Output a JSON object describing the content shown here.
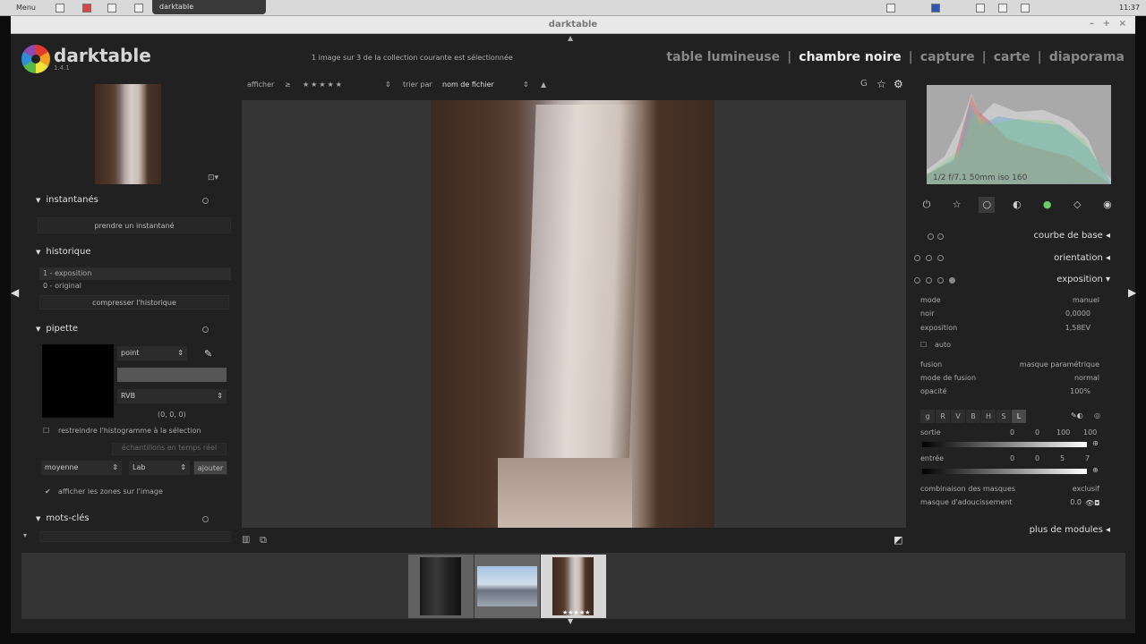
{
  "system": {
    "left_text": "Menu",
    "task_title": "darktable",
    "clock": "11:37"
  },
  "window": {
    "title": "darktable",
    "minimize": "–",
    "maximize": "+",
    "close": "×"
  },
  "app": {
    "name": "darktable",
    "version": "1.4.1",
    "selection_info": "1 image sur 3 de la collection courante est sélectionnée"
  },
  "views": [
    "table lumineuse",
    "chambre noire",
    "capture",
    "carte",
    "diaporama"
  ],
  "views_sep": "|",
  "left": {
    "snapshots": {
      "title": "instantanés",
      "button": "prendre un instantané"
    },
    "history": {
      "title": "historique",
      "items": [
        "1 - exposition",
        "0 - original"
      ],
      "compress": "compresser l'historique"
    },
    "pipette": {
      "title": "pipette",
      "mode": "point",
      "model": "RVB",
      "values": "(0, 0, 0)",
      "restrict_label": "restreindre l'histogramme à la sélection",
      "live_label": "échantillons en temps réel",
      "stat": "moyenne",
      "space": "Lab",
      "add": "ajouter",
      "show_zones": "afficher les zones sur l'image"
    },
    "tags": {
      "title": "mots-clés"
    }
  },
  "center_toolbar": {
    "show_label": "afficher",
    "stars": "★★★★★",
    "sort_label": "trier par",
    "sort_value": "nom de fichier"
  },
  "right": {
    "hist_info": "1/2 f/7.1 50mm iso 160",
    "modules": [
      "courbe de base",
      "orientation",
      "exposition"
    ],
    "exposure": {
      "mode_label": "mode",
      "mode_value": "manuel",
      "black_label": "noir",
      "black_value": "0,0000",
      "exp_label": "exposition",
      "exp_value": "1,58EV",
      "auto_label": "auto",
      "fusion_label": "fusion",
      "fusion_value": "masque paramétrique",
      "blend_label": "mode de fusion",
      "blend_value": "normal",
      "opacity_label": "opacité",
      "opacity_value": "100%",
      "channels": [
        "g",
        "R",
        "V",
        "B",
        "H",
        "S",
        "L"
      ],
      "output_label": "sortie",
      "output_values": [
        "0",
        "0",
        "100",
        "100"
      ],
      "input_label": "entrée",
      "input_values": [
        "0",
        "0",
        "5",
        "7"
      ],
      "comb_label": "combinaison des masques",
      "comb_value": "exclusif",
      "soften_label": "masque d'adoucissement",
      "soften_value": "0.0"
    },
    "more_modules": "plus de modules"
  }
}
